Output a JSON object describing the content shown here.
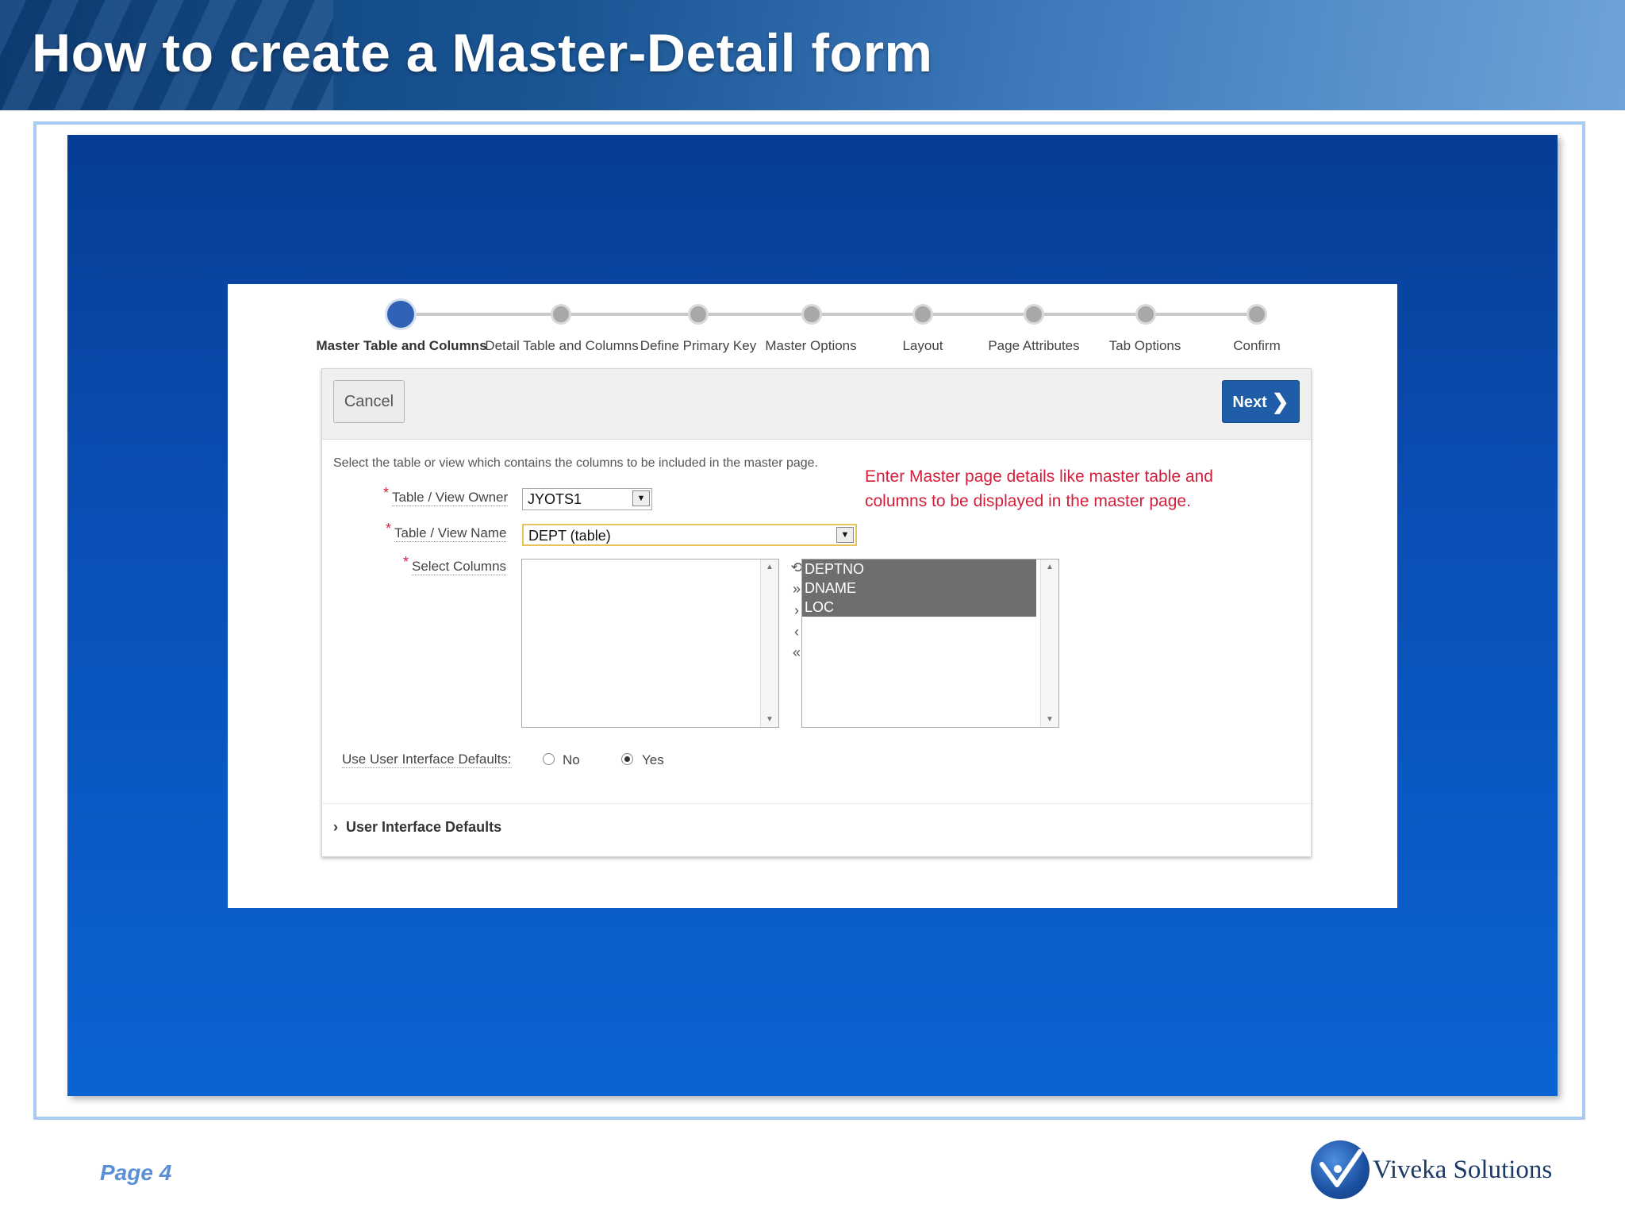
{
  "slide": {
    "title": "How to create a Master-Detail form",
    "page_label": "Page 4",
    "brand": "Viveka Solutions"
  },
  "wizard": {
    "steps": [
      {
        "label": "Master Table and Columns",
        "active": true
      },
      {
        "label": "Detail Table and Columns",
        "active": false
      },
      {
        "label": "Define Primary Key",
        "active": false
      },
      {
        "label": "Master Options",
        "active": false
      },
      {
        "label": "Layout",
        "active": false
      },
      {
        "label": "Page Attributes",
        "active": false
      },
      {
        "label": "Tab Options",
        "active": false
      },
      {
        "label": "Confirm",
        "active": false
      }
    ],
    "cancel_label": "Cancel",
    "next_label": "Next"
  },
  "form": {
    "instruction": "Select the table or view which contains the columns to be included in the master page.",
    "note": "Enter Master page details like master table and columns to be displayed in the master page.",
    "owner_label": "Table / View Owner",
    "owner_value": "JYOTS1",
    "name_label": "Table / View Name",
    "name_value": "DEPT (table)",
    "columns_label": "Select Columns",
    "available_columns": [],
    "selected_columns": [
      "DEPTNO",
      "DNAME",
      "LOC"
    ],
    "ui_defaults_label": "Use User Interface Defaults:",
    "ui_defaults_options": [
      "No",
      "Yes"
    ],
    "ui_defaults_selected": "Yes",
    "section_title": "User Interface Defaults"
  },
  "colors": {
    "accent_blue": "#1f5da8",
    "note_red": "#d41d3a",
    "panel_blue": "#0a4fb5"
  }
}
